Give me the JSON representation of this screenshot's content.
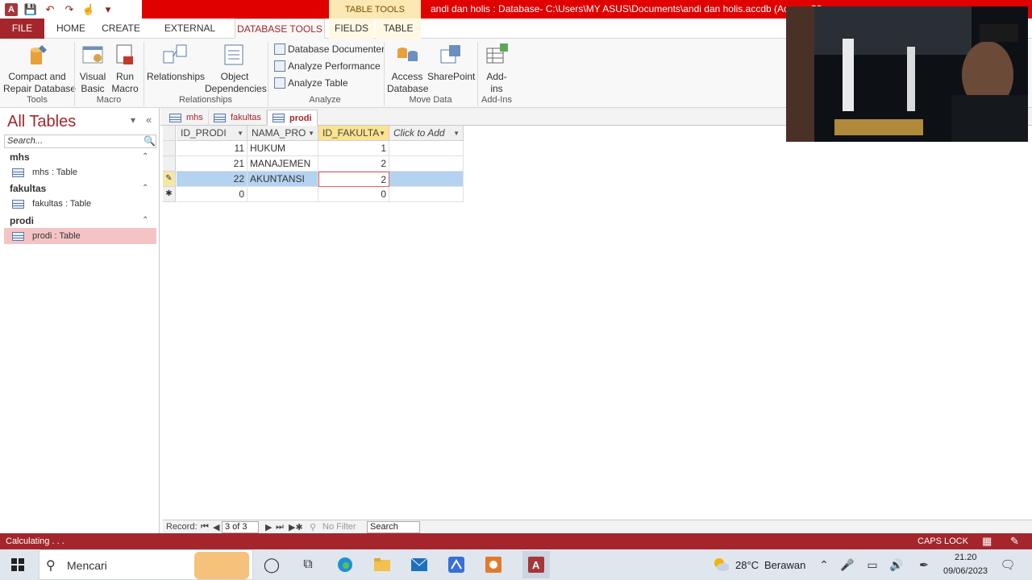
{
  "window": {
    "title": "andi dan holis : Database- C:\\Users\\MY ASUS\\Documents\\andi dan holis.accdb (Access 20",
    "context_tab_group": "TABLE TOOLS"
  },
  "ribbon_tabs": [
    "FILE",
    "HOME",
    "CREATE",
    "EXTERNAL DATA",
    "DATABASE TOOLS",
    "FIELDS",
    "TABLE"
  ],
  "ribbon": {
    "tools": {
      "label": "Tools",
      "compact_repair": "Compact and\nRepair Database"
    },
    "macro": {
      "label": "Macro",
      "visual_basic": "Visual\nBasic",
      "run_macro": "Run\nMacro"
    },
    "relationships": {
      "label": "Relationships",
      "relationships": "Relationships",
      "object_dependencies": "Object\nDependencies"
    },
    "analyze": {
      "label": "Analyze",
      "documenter": "Database Documenter",
      "performance": "Analyze Performance",
      "table": "Analyze Table"
    },
    "move_data": {
      "label": "Move Data",
      "access_db": "Access\nDatabase",
      "sharepoint": "SharePoint"
    },
    "addins": {
      "label": "Add-Ins",
      "addins": "Add-\nins"
    }
  },
  "nav": {
    "title": "All Tables",
    "search_placeholder": "Search...",
    "groups": [
      {
        "name": "mhs",
        "item": "mhs : Table"
      },
      {
        "name": "fakultas",
        "item": "fakultas : Table"
      },
      {
        "name": "prodi",
        "item": "prodi : Table"
      }
    ]
  },
  "doc_tabs": [
    "mhs",
    "fakultas",
    "prodi"
  ],
  "datasheet": {
    "columns": [
      "ID_PRODI",
      "NAMA_PRO",
      "ID_FAKULTA",
      "Click to Add"
    ],
    "rows": [
      [
        "11",
        "HUKUM",
        "1"
      ],
      [
        "21",
        "MANAJEMEN",
        "2"
      ],
      [
        "22",
        "AKUNTANSI",
        "2"
      ],
      [
        "0",
        "",
        "0"
      ]
    ]
  },
  "record_nav": {
    "label": "Record:",
    "position": "3 of 3",
    "filter": "No Filter",
    "search": "Search"
  },
  "status": {
    "left": "Calculating . . .",
    "caps": "CAPS LOCK"
  },
  "taskbar": {
    "search": "Mencari",
    "weather_temp": "28°C",
    "weather_text": "Berawan",
    "time": "21.20",
    "date": "09/06/2023"
  }
}
